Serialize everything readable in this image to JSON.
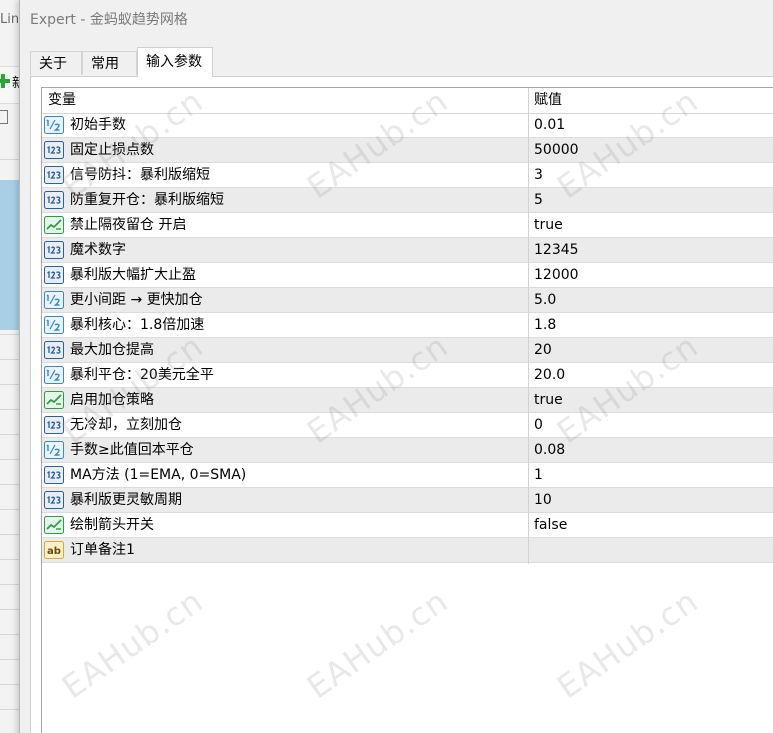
{
  "background_window": {
    "title_fragment": "Lin",
    "toolbar_char": "新"
  },
  "dialog": {
    "title": "Expert - 金蚂蚁趋势网格"
  },
  "tabs": [
    {
      "label": "关于",
      "active": false
    },
    {
      "label": "常用",
      "active": false
    },
    {
      "label": "输入参数",
      "active": true
    }
  ],
  "grid": {
    "columns": [
      "变量",
      "赋值"
    ],
    "rows": [
      {
        "icon": "double-icon",
        "name": "初始手数",
        "value": "0.01"
      },
      {
        "icon": "integer-icon",
        "name": "固定止损点数",
        "value": "50000"
      },
      {
        "icon": "integer-icon",
        "name": "信号防抖：暴利版缩短",
        "value": "3"
      },
      {
        "icon": "integer-icon",
        "name": "防重复开仓：暴利版缩短",
        "value": "5"
      },
      {
        "icon": "boolean-icon",
        "name": "禁止隔夜留仓 开启",
        "value": "true"
      },
      {
        "icon": "integer-icon",
        "name": "魔术数字",
        "value": "12345"
      },
      {
        "icon": "integer-icon",
        "name": "暴利版大幅扩大止盈",
        "value": "12000"
      },
      {
        "icon": "double-icon",
        "name": "更小间距 → 更快加仓",
        "value": "5.0"
      },
      {
        "icon": "double-icon",
        "name": "暴利核心：1.8倍加速",
        "value": "1.8"
      },
      {
        "icon": "integer-icon",
        "name": "最大加仓提高",
        "value": "20"
      },
      {
        "icon": "double-icon",
        "name": "暴利平仓：20美元全平",
        "value": "20.0"
      },
      {
        "icon": "boolean-icon",
        "name": "启用加仓策略",
        "value": "true"
      },
      {
        "icon": "integer-icon",
        "name": "无冷却，立刻加仓",
        "value": "0"
      },
      {
        "icon": "double-icon",
        "name": "手数≥此值回本平仓",
        "value": "0.08"
      },
      {
        "icon": "integer-icon",
        "name": "MA方法 (1=EMA, 0=SMA)",
        "value": "1"
      },
      {
        "icon": "integer-icon",
        "name": "暴利版更灵敏周期",
        "value": "10"
      },
      {
        "icon": "boolean-icon",
        "name": "绘制箭头开关",
        "value": "false"
      },
      {
        "icon": "string-icon",
        "name": "订单备注1",
        "value": ""
      }
    ]
  },
  "watermark": "EAHub.cn",
  "colors": {
    "alt_row": "#ebebeb",
    "icon_double": "#3b87c8",
    "icon_integer": "#2f5f97",
    "icon_boolean": "#2e9e45",
    "icon_string": "#d8a93a"
  }
}
